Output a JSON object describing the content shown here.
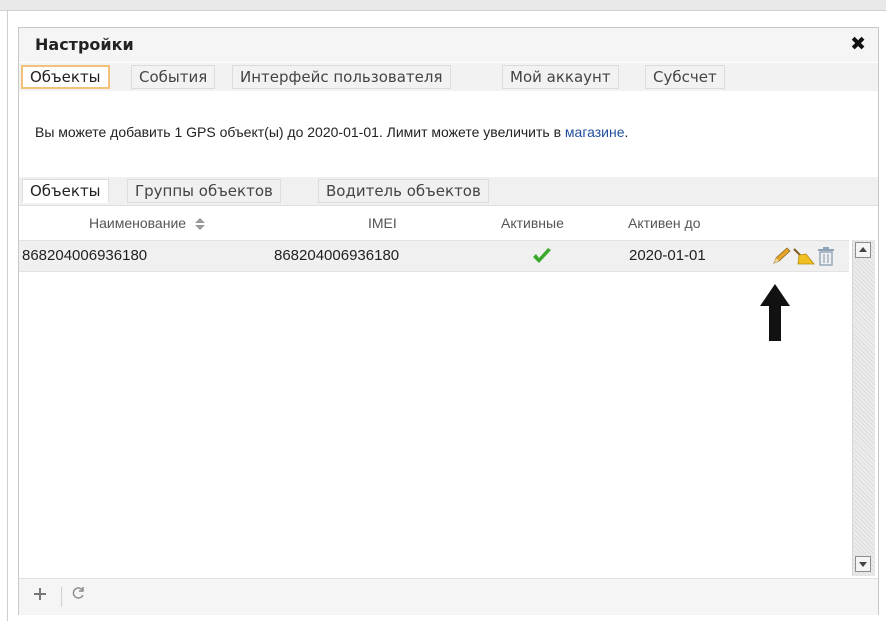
{
  "dialog": {
    "title": "Настройки",
    "close_symbol": "✖"
  },
  "outer_tabs": [
    {
      "label": "Объекты",
      "active": true
    },
    {
      "label": "События",
      "active": false
    },
    {
      "label": "Интерфейс пользователя",
      "active": false
    },
    {
      "label": "Мой аккаунт",
      "active": false
    },
    {
      "label": "Субсчет",
      "active": false
    }
  ],
  "notice": {
    "text": "Вы можете добавить 1 GPS объект(ы) до 2020-01-01. Лимит можете увеличить в ",
    "link": "магазине",
    "after": "."
  },
  "inner_tabs": [
    {
      "label": "Объекты",
      "active": true
    },
    {
      "label": "Группы объектов",
      "active": false
    },
    {
      "label": "Водитель объектов",
      "active": false
    }
  ],
  "grid": {
    "columns": [
      "Наименование",
      "IMEI",
      "Активные",
      "Активен до"
    ],
    "rows": [
      {
        "name": "868204006936180",
        "imei": "868204006936180",
        "active": true,
        "active_until": "2020-01-01"
      }
    ]
  },
  "icons": {
    "sort": "sort-updown-icon",
    "active_check": "checkmark-icon",
    "edit": "pencil-icon",
    "clear": "broom-icon",
    "delete": "trash-icon",
    "add": "plus-icon",
    "refresh": "refresh-icon",
    "annotation": "arrow-up-icon"
  },
  "colors": {
    "active_tab_border": "#f2c27a",
    "link": "#1f4f9e",
    "check": "#3aa82a"
  }
}
